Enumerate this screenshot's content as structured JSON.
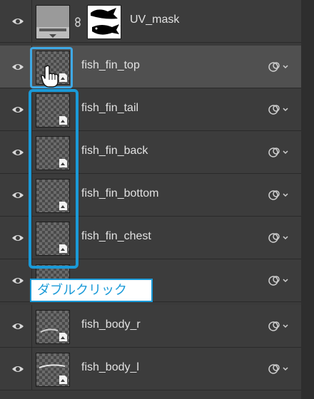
{
  "layers": {
    "mask_layer": {
      "name": "UV_mask"
    },
    "items": [
      {
        "name": "fish_fin_top",
        "selected": true
      },
      {
        "name": "fish_fin_tail"
      },
      {
        "name": "fish_fin_back"
      },
      {
        "name": "fish_fin_bottom"
      },
      {
        "name": "fish_fin_chest"
      },
      {
        "name": ""
      },
      {
        "name": "fish_body_r"
      },
      {
        "name": "fish_body_l"
      }
    ]
  },
  "annotation": {
    "tooltip_text": "ダブルクリック",
    "highlight_color": "#1a9ad8"
  },
  "icons": {
    "visibility": "eye-icon",
    "smart_object": "smart-object-badge-icon",
    "effects": "layer-effects-icon",
    "chain": "chain-link-icon",
    "cursor": "hand-pointer-icon"
  }
}
